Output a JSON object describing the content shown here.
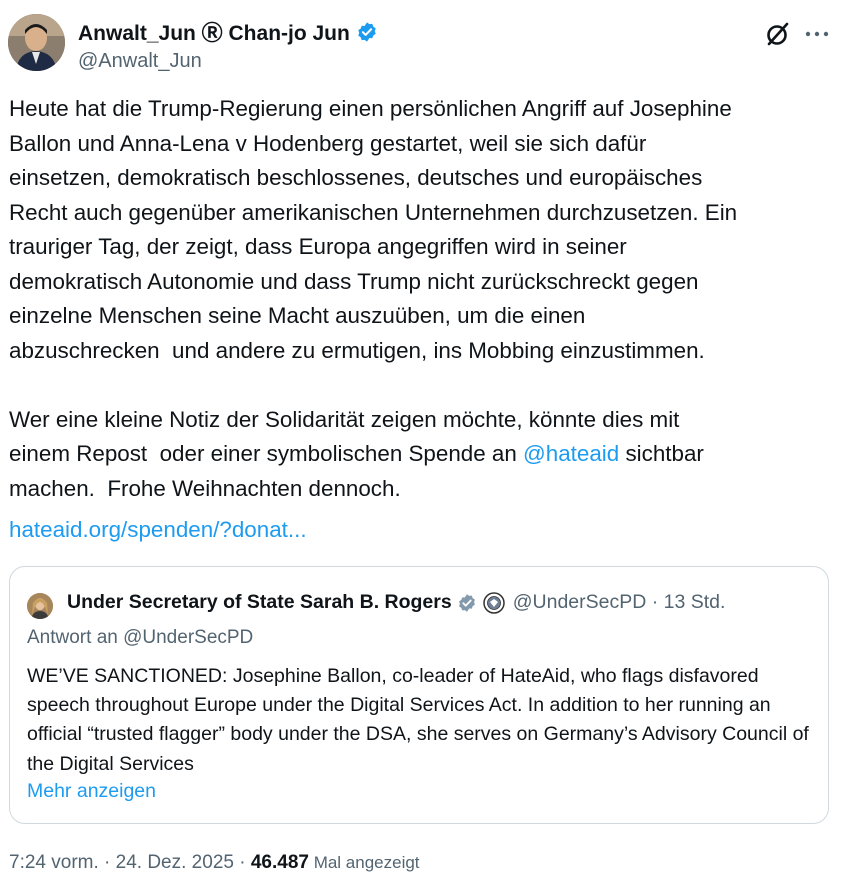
{
  "author": {
    "display_name": "Anwalt_Jun Ⓡ Chan-jo Jun",
    "handle": "@Anwalt_Jun",
    "avatar": "profile-photo"
  },
  "icons": {
    "verified": "verified-badge-icon",
    "grok": "grok-icon",
    "more": "more-options-icon"
  },
  "tweet": {
    "paragraph1": "Heute hat die Trump-Regierung einen persönlichen Angriff auf Josephine\nBallon und Anna-Lena v Hodenberg gestartet, weil sie sich dafür\neinsetzen, demokratisch beschlossenes, deutsches und europäisches\nRecht auch gegenüber amerikanischen Unternehmen durchzusetzen. Ein\ntrauriger Tag, der zeigt, dass Europa angegriffen wird in seiner\ndemokratisch Autonomie und dass Trump nicht zurückschreckt gegen\neinzelne Menschen seine Macht auszuüben, um die einen\nabzuschrecken  und andere zu ermutigen, ins Mobbing einzustimmen.",
    "paragraph2_before": "Wer eine kleine Notiz der Solidarität zeigen möchte, könnte dies mit\neinem Repost  oder einer symbolischen Spende an ",
    "mention": "@hateaid",
    "paragraph2_after": " sichtbar\nmachen.  Frohe Weihnachten dennoch.",
    "link": "hateaid.org/spenden/?donat..."
  },
  "quote": {
    "display_name": "Under Secretary of State Sarah B. Rogers",
    "handle": "@UnderSecPD · 13 Std.",
    "reply_to": "Antwort an @UnderSecPD",
    "text": "WE’VE SANCTIONED: Josephine Ballon, co-leader of HateAid, who flags disfavored speech throughout Europe under the Digital Services Act. In addition to her running an official “trusted flagger” body under the DSA, she serves on Germany’s Advisory Council of the Digital Services",
    "show_more": "Mehr anzeigen"
  },
  "meta": {
    "time": "7:24 vorm. · 24. Dez. 2025 · ",
    "views": "46.487",
    "views_label": " Mal angezeigt"
  },
  "colors": {
    "accent": "#1d9bf0",
    "text": "#0f1419",
    "secondary": "#536471",
    "border": "#cfd9de"
  }
}
